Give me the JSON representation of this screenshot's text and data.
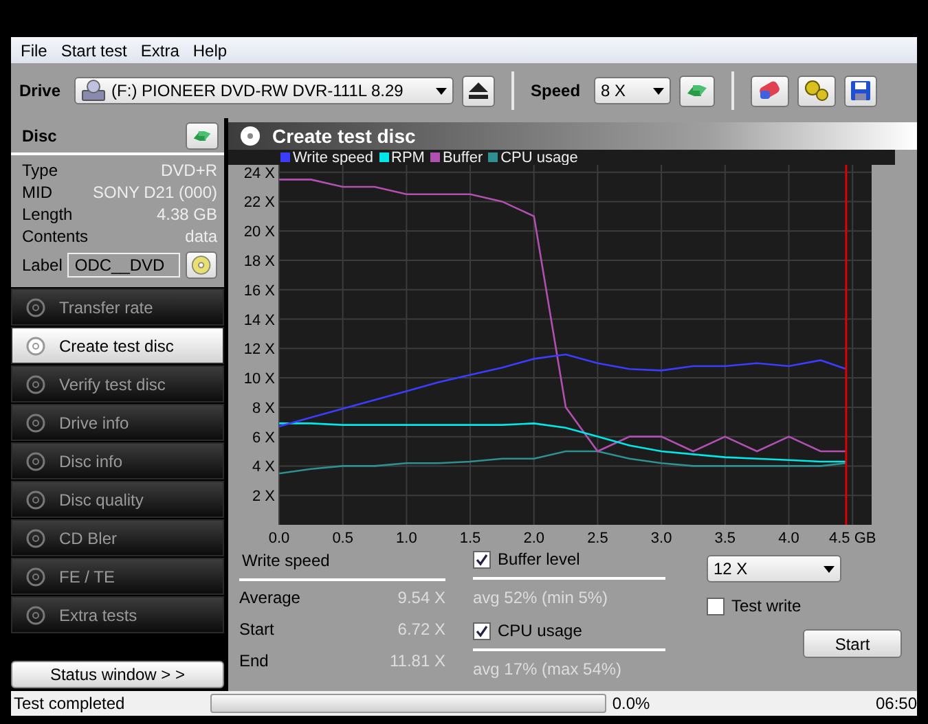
{
  "menu": [
    "File",
    "Start test",
    "Extra",
    "Help"
  ],
  "toolbar": {
    "drive_label": "Drive",
    "drive": "(F:)   PIONEER DVD-RW  DVR-111L 8.29",
    "speed_label": "Speed",
    "speed": "8 X"
  },
  "disc": {
    "title": "Disc",
    "info": [
      {
        "label": "Type",
        "value": "DVD+R"
      },
      {
        "label": "MID",
        "value": "SONY D21 (000)"
      },
      {
        "label": "Length",
        "value": "4.38 GB"
      },
      {
        "label": "Contents",
        "value": "data"
      }
    ],
    "label_caption": "Label",
    "label_value": "ODC__DVD"
  },
  "nav": [
    {
      "label": "Transfer rate",
      "selected": false
    },
    {
      "label": "Create test disc",
      "selected": true
    },
    {
      "label": "Verify test disc",
      "selected": false
    },
    {
      "label": "Drive info",
      "selected": false
    },
    {
      "label": "Disc info",
      "selected": false
    },
    {
      "label": "Disc quality",
      "selected": false
    },
    {
      "label": "CD Bler",
      "selected": false
    },
    {
      "label": "FE / TE",
      "selected": false
    },
    {
      "label": "Extra tests",
      "selected": false
    }
  ],
  "status_window_button": "Status window > >",
  "panel_title": "Create test disc",
  "chart_data": {
    "type": "line",
    "x": [
      0,
      0.25,
      0.5,
      0.75,
      1,
      1.25,
      1.5,
      1.75,
      2,
      2.25,
      2.5,
      2.75,
      3,
      3.25,
      3.5,
      3.75,
      4,
      4.25,
      4.45
    ],
    "xlim": [
      0,
      4.65
    ],
    "ylim": [
      0,
      24.5
    ],
    "xticks": [
      {
        "value": 0,
        "label": "0.0"
      },
      {
        "value": 0.5,
        "label": "0.5"
      },
      {
        "value": 1,
        "label": "1.0"
      },
      {
        "value": 1.5,
        "label": "1.5"
      },
      {
        "value": 2,
        "label": "2.0"
      },
      {
        "value": 2.5,
        "label": "2.5"
      },
      {
        "value": 3,
        "label": "3.0"
      },
      {
        "value": 3.5,
        "label": "3.5"
      },
      {
        "value": 4,
        "label": "4.0"
      },
      {
        "value": 4.5,
        "label": "4.5 GB"
      }
    ],
    "yticks": [
      {
        "value": 2,
        "label": "2 X"
      },
      {
        "value": 4,
        "label": "4 X"
      },
      {
        "value": 6,
        "label": "6 X"
      },
      {
        "value": 8,
        "label": "8 X"
      },
      {
        "value": 10,
        "label": "10 X"
      },
      {
        "value": 12,
        "label": "12 X"
      },
      {
        "value": 14,
        "label": "14 X"
      },
      {
        "value": 16,
        "label": "16 X"
      },
      {
        "value": 18,
        "label": "18 X"
      },
      {
        "value": 20,
        "label": "20 X"
      },
      {
        "value": 22,
        "label": "22 X"
      },
      {
        "value": 24,
        "label": "24 X"
      }
    ],
    "series": [
      {
        "name": "Write speed",
        "color": "#3c3cff",
        "values": [
          6.7,
          7.3,
          7.9,
          8.5,
          9.1,
          9.7,
          10.2,
          10.7,
          11.3,
          11.6,
          11.0,
          10.6,
          10.5,
          10.8,
          10.8,
          11.0,
          10.8,
          11.2,
          10.6
        ]
      },
      {
        "name": "RPM",
        "color": "#00e8e8",
        "values": [
          6.9,
          6.9,
          6.8,
          6.8,
          6.8,
          6.8,
          6.8,
          6.8,
          6.9,
          6.6,
          6.0,
          5.4,
          5.0,
          4.8,
          4.6,
          4.5,
          4.4,
          4.3,
          4.3
        ]
      },
      {
        "name": "Buffer",
        "color": "#b050b0",
        "values": [
          23.5,
          23.5,
          23,
          23,
          22.5,
          22.5,
          22.5,
          22,
          21,
          8,
          5,
          6,
          6,
          5,
          6,
          5,
          6,
          5,
          5
        ]
      },
      {
        "name": "CPU usage",
        "color": "#2e9090",
        "values": [
          3.5,
          3.8,
          4,
          4,
          4.2,
          4.2,
          4.3,
          4.5,
          4.5,
          5,
          5,
          4.5,
          4.2,
          4,
          4,
          4,
          4,
          4,
          4.2
        ]
      }
    ],
    "ref_lines": [
      {
        "axis": "x",
        "value": 4.45,
        "color": "#e00000"
      }
    ],
    "grid": true,
    "legend": true
  },
  "write_speed": {
    "title": "Write speed",
    "rows": [
      {
        "label": "Average",
        "value": "9.54 X"
      },
      {
        "label": "Start",
        "value": "6.72 X"
      },
      {
        "label": "End",
        "value": "11.81 X"
      }
    ]
  },
  "buffer": {
    "label": "Buffer level",
    "checked": true,
    "summary": "avg 52% (min 5%)"
  },
  "cpu": {
    "label": "CPU usage",
    "checked": true,
    "summary": "avg 17% (max 54%)"
  },
  "test_speed": "12 X",
  "test_write": {
    "label": "Test write",
    "checked": false
  },
  "start_button": "Start",
  "status_bar": {
    "message": "Test completed",
    "progress": {
      "level": 0
    },
    "percent": "0.0%",
    "time": "06:50"
  }
}
